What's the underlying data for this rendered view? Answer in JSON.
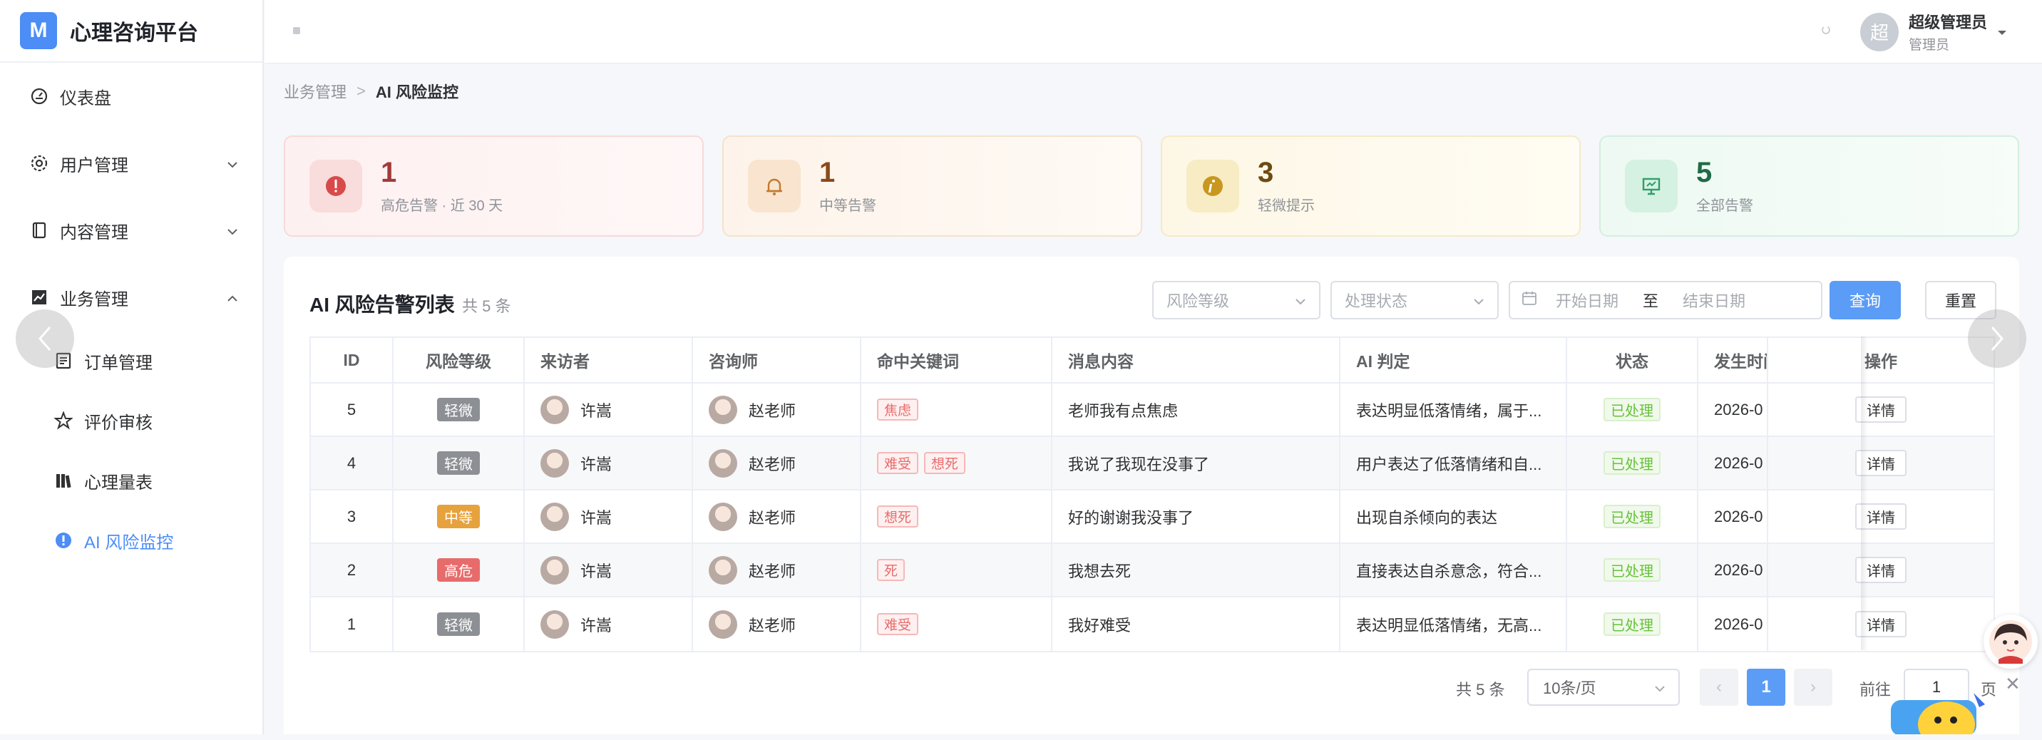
{
  "app": {
    "logo_letter": "M",
    "title": "心理咨询平台"
  },
  "sidebar": {
    "items": [
      {
        "label": "仪表盘",
        "icon": "gauge-icon"
      },
      {
        "label": "用户管理",
        "icon": "gear-icon"
      },
      {
        "label": "内容管理",
        "icon": "book-icon"
      },
      {
        "label": "业务管理",
        "icon": "chart-icon"
      }
    ],
    "sub_items": [
      {
        "label": "订单管理",
        "icon": "document-icon"
      },
      {
        "label": "评价审核",
        "icon": "star-icon"
      },
      {
        "label": "心理量表",
        "icon": "books-icon"
      },
      {
        "label": "AI 风险监控",
        "icon": "alert-circle-icon"
      }
    ]
  },
  "header": {
    "avatar_text": "超",
    "user_name": "超级管理员",
    "user_role": "管理员"
  },
  "breadcrumb": {
    "parent": "业务管理",
    "current": "AI 风险监控"
  },
  "stats": [
    {
      "value": "1",
      "label": "高危告警 · 近 30 天",
      "icon": "exclamation-icon",
      "color": "#d84a4a"
    },
    {
      "value": "1",
      "label": "中等告警",
      "icon": "bell-icon",
      "color": "#c27a2c"
    },
    {
      "value": "3",
      "label": "轻微提示",
      "icon": "info-icon",
      "color": "#b8860b"
    },
    {
      "value": "5",
      "label": "全部告警",
      "icon": "presentation-icon",
      "color": "#2f9e6a"
    }
  ],
  "panel": {
    "title": "AI 风险告警列表",
    "count": "共 5 条",
    "filters": {
      "risk_placeholder": "风险等级",
      "status_placeholder": "处理状态",
      "start_placeholder": "开始日期",
      "range_sep": "至",
      "end_placeholder": "结束日期"
    },
    "query_label": "查询",
    "reset_label": "重置"
  },
  "table": {
    "headers": [
      "ID",
      "风险等级",
      "来访者",
      "咨询师",
      "命中关键词",
      "消息内容",
      "AI 判定",
      "状态",
      "发生时间",
      "操作"
    ],
    "rows": [
      {
        "id": "5",
        "risk": "轻微",
        "risk_level": "light",
        "visitor": "许嵩",
        "counselor": "赵老师",
        "keywords": [
          "焦虑"
        ],
        "message": "老师我有点焦虑",
        "ai": "表达明显低落情绪，属于...",
        "status": "已处理",
        "time": "2026-0",
        "action": "详情"
      },
      {
        "id": "4",
        "risk": "轻微",
        "risk_level": "light",
        "visitor": "许嵩",
        "counselor": "赵老师",
        "keywords": [
          "难受",
          "想死"
        ],
        "message": "我说了我现在没事了",
        "ai": "用户表达了低落情绪和自...",
        "status": "已处理",
        "time": "2026-0",
        "action": "详情"
      },
      {
        "id": "3",
        "risk": "中等",
        "risk_level": "mid",
        "visitor": "许嵩",
        "counselor": "赵老师",
        "keywords": [
          "想死"
        ],
        "message": "好的谢谢我没事了",
        "ai": "出现自杀倾向的表达",
        "status": "已处理",
        "time": "2026-0",
        "action": "详情"
      },
      {
        "id": "2",
        "risk": "高危",
        "risk_level": "high",
        "visitor": "许嵩",
        "counselor": "赵老师",
        "keywords": [
          "死"
        ],
        "message": "我想去死",
        "ai": "直接表达自杀意念，符合...",
        "status": "已处理",
        "time": "2026-0",
        "action": "详情"
      },
      {
        "id": "1",
        "risk": "轻微",
        "risk_level": "light",
        "visitor": "许嵩",
        "counselor": "赵老师",
        "keywords": [
          "难受"
        ],
        "message": "我好难受",
        "ai": "表达明显低落情绪，无高...",
        "status": "已处理",
        "time": "2026-0",
        "action": "详情"
      }
    ]
  },
  "pagination": {
    "total": "共 5 条",
    "page_size": "10条/页",
    "current": "1",
    "goto_label": "前往",
    "goto_value": "1",
    "unit": "页"
  }
}
